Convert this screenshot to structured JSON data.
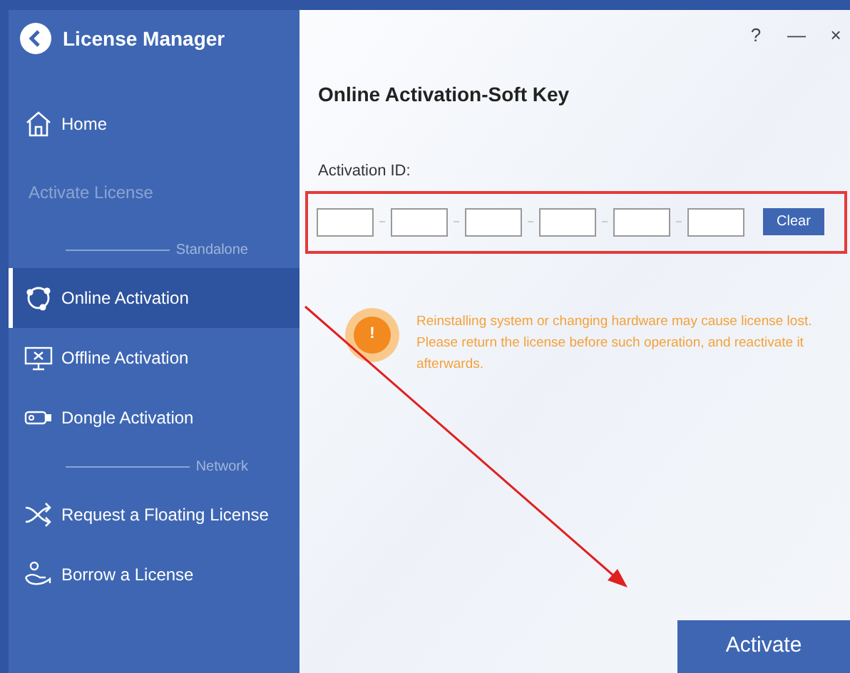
{
  "app": {
    "title": "License Manager"
  },
  "window_controls": [
    "?",
    "—",
    "×"
  ],
  "sidebar": [
    {
      "kind": "item",
      "label": "Home",
      "selected": false
    },
    {
      "kind": "heading",
      "label": "Activate License"
    },
    {
      "kind": "divider",
      "label": "Standalone"
    },
    {
      "kind": "item",
      "label": "Online Activation",
      "selected": true
    },
    {
      "kind": "item",
      "label": "Offline Activation",
      "selected": false
    },
    {
      "kind": "item",
      "label": "Dongle Activation",
      "selected": false
    },
    {
      "kind": "divider",
      "label": "Network"
    },
    {
      "kind": "item",
      "label": "Request a Floating License",
      "selected": false
    },
    {
      "kind": "item",
      "label": "Borrow a License",
      "selected": false
    }
  ],
  "page_title": "Online Activation-Soft Key",
  "activation_id": {
    "label": "Activation ID:",
    "fields": [
      {
        "kind": "input"
      },
      {
        "kind": "input"
      },
      {
        "kind": "input"
      },
      {
        "kind": "input"
      },
      {
        "kind": "input"
      },
      {
        "kind": "input"
      }
    ],
    "clear_button": "Clear"
  },
  "warning": {
    "icon": "!",
    "text": "Reinstalling system or changing hardware may cause license lost. Please return the license before such operation, and reactivate it afterwards."
  },
  "activate_button": "Activate"
}
